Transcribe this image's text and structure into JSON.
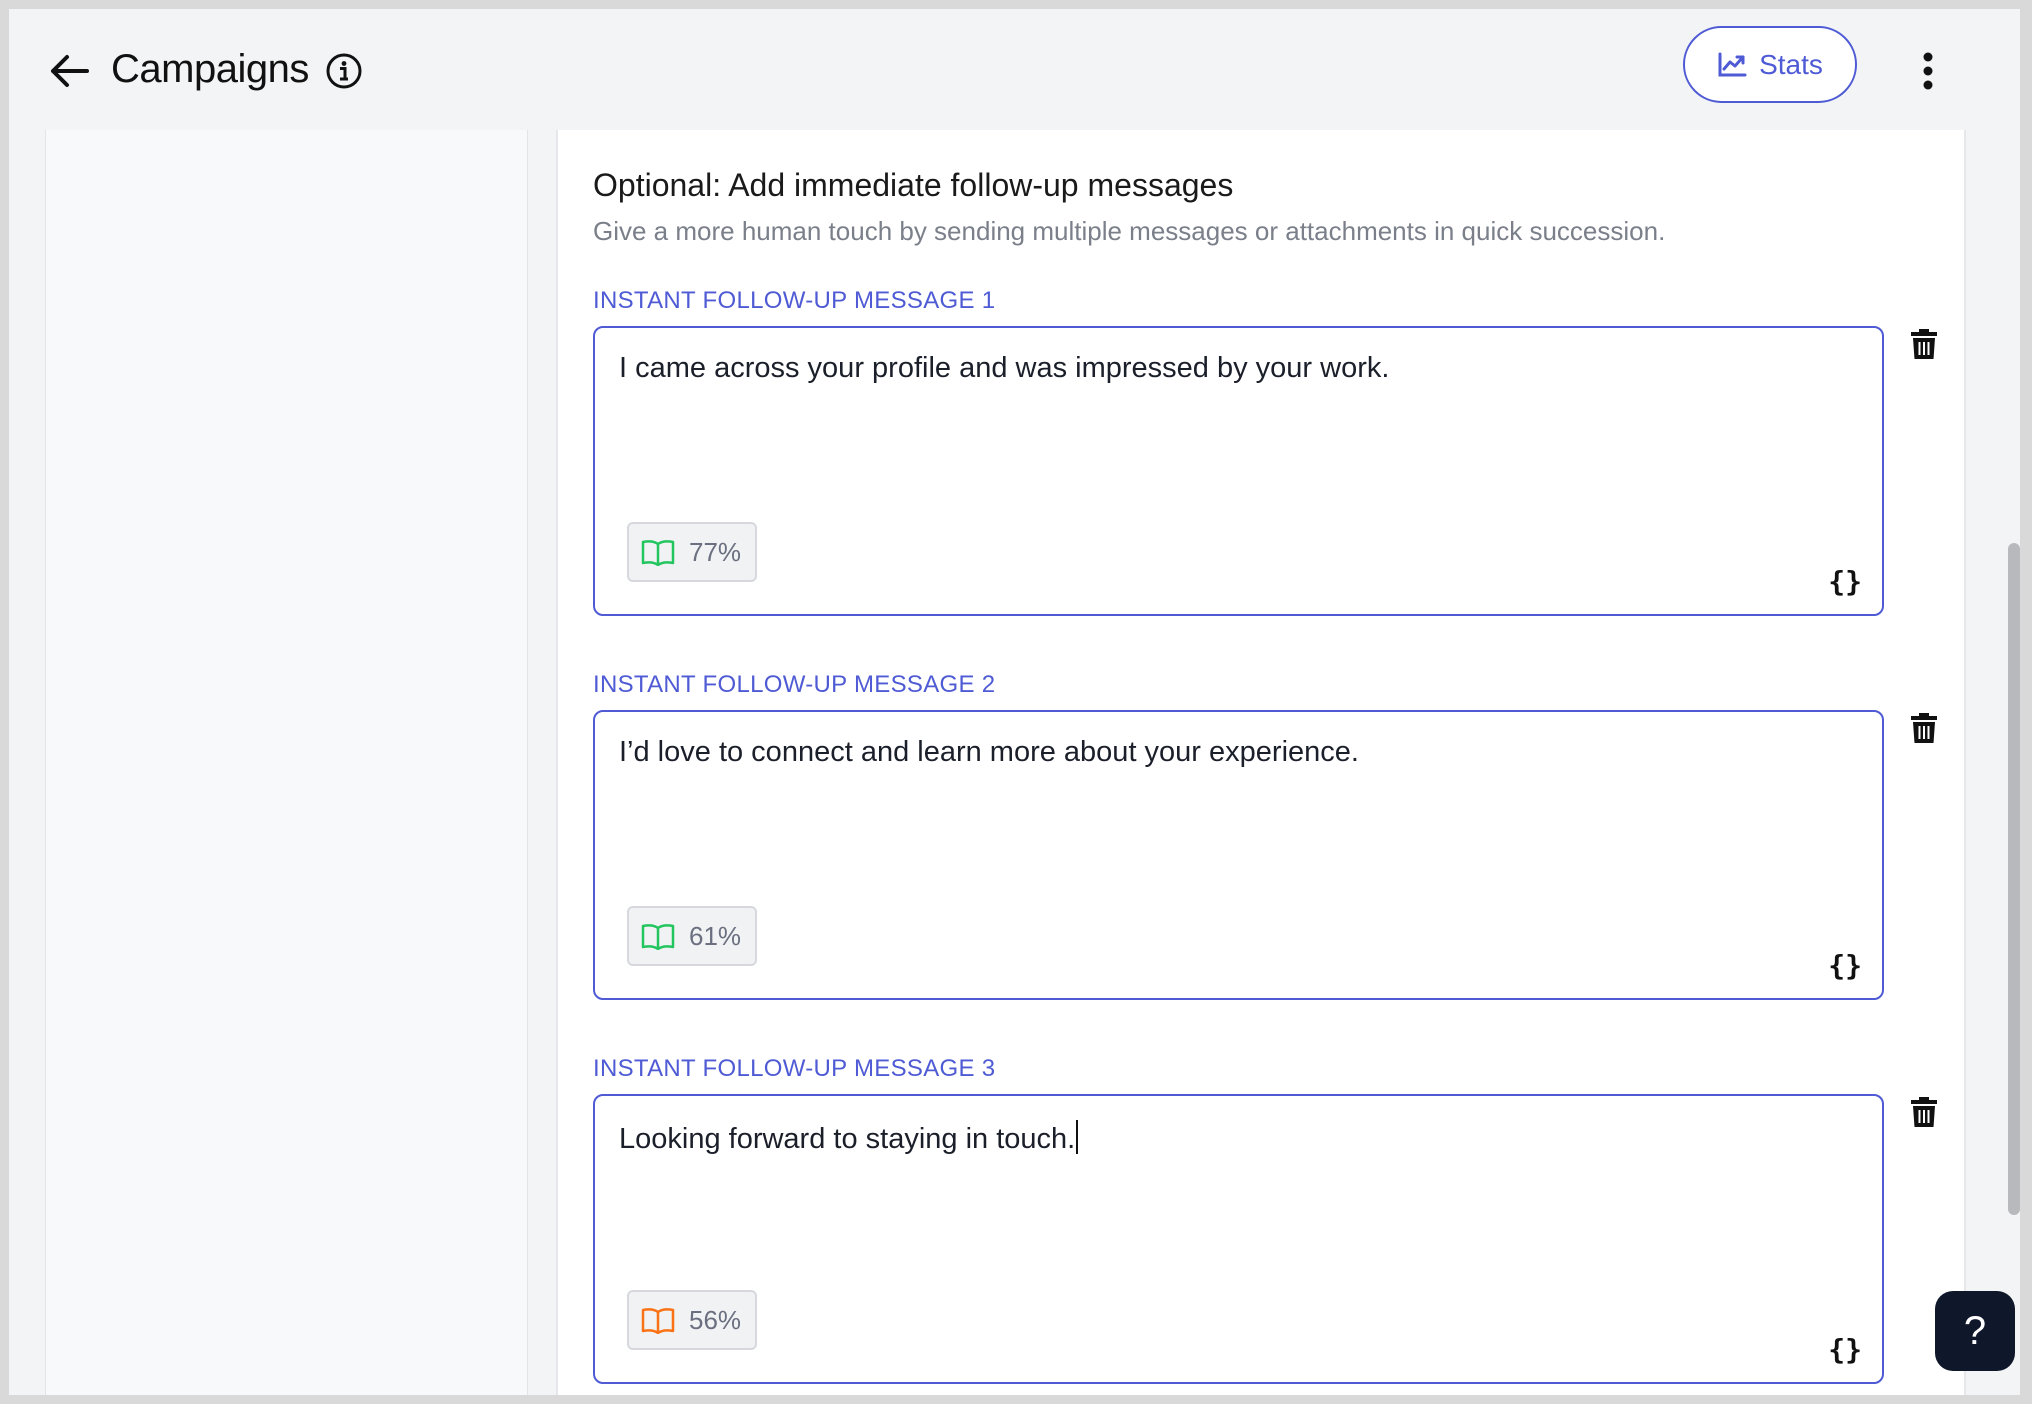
{
  "header": {
    "title": "Campaigns",
    "stats_label": "Stats"
  },
  "section": {
    "title": "Optional: Add immediate follow-up messages",
    "subtitle": "Give a more human touch by sending multiple messages or attachments in quick succession."
  },
  "messages": [
    {
      "label": "INSTANT FOLLOW-UP MESSAGE 1",
      "text": "I came across your profile and was impressed by your work.",
      "score": "77%",
      "score_color": "#22c55e",
      "variables_label": "{}"
    },
    {
      "label": "INSTANT FOLLOW-UP MESSAGE 2",
      "text": "I’d love to connect and learn more about your experience.",
      "score": "61%",
      "score_color": "#22c55e",
      "variables_label": "{}"
    },
    {
      "label": "INSTANT FOLLOW-UP MESSAGE 3",
      "text": "Looking forward to staying in touch.",
      "score": "56%",
      "score_color": "#f97316",
      "variables_label": "{}"
    }
  ],
  "help": {
    "label": "?"
  },
  "colors": {
    "accent": "#4f5bd5",
    "help_bg": "#0f172a"
  },
  "icons": [
    "arrow-left-icon",
    "info-icon",
    "chart-line-icon",
    "kebab-icon",
    "book-icon",
    "braces-icon",
    "trash-icon",
    "question-icon"
  ]
}
